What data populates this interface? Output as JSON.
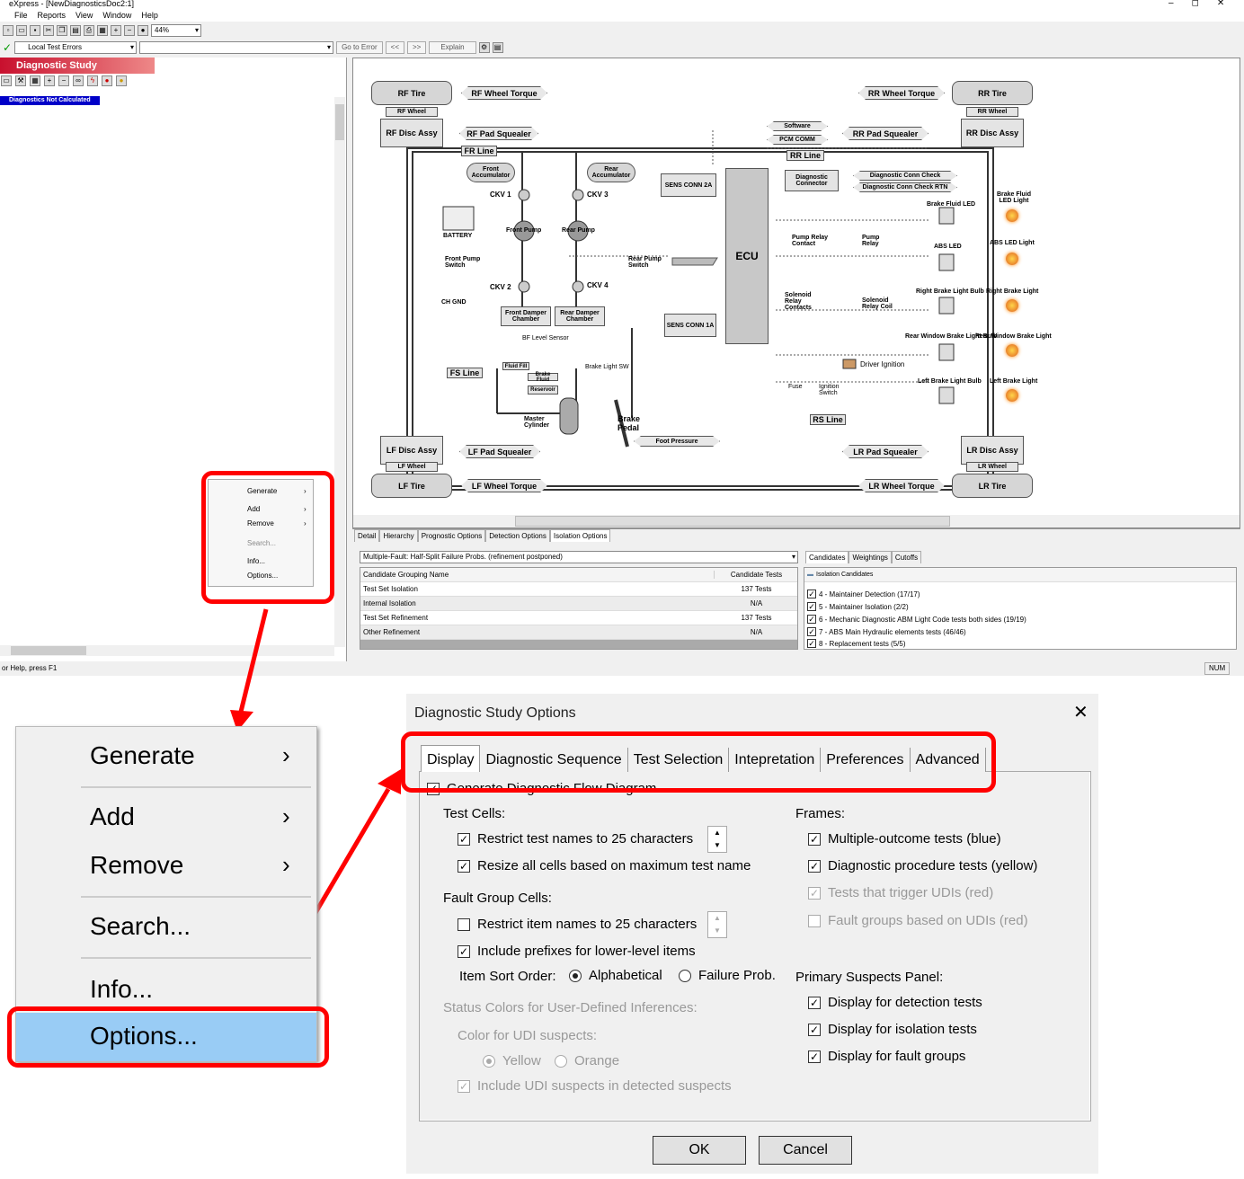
{
  "app": {
    "title": "eXpress - [NewDiagnosticsDoc2:1]",
    "menu": [
      "File",
      "Reports",
      "View",
      "Window",
      "Help"
    ],
    "zoom": "44%",
    "filter": "Local Test Errors",
    "buttons": {
      "goto_error": "Go to Error",
      "prev": "<<",
      "next": ">>",
      "explain": "Explain"
    },
    "window_controls": [
      "–",
      "◻",
      "✕"
    ]
  },
  "study": {
    "title": "Diagnostic Study",
    "badge": "Diagnostics Not Calculated",
    "badge_color": "#0000c8",
    "title_color": "#c8102e"
  },
  "diagram": {
    "boxes": {
      "rf_tire": "RF Tire",
      "rf_wheel": "RF Wheel",
      "rf_disc": "RF Disc Assy",
      "rr_tire": "RR Tire",
      "rr_wheel": "RR Wheel",
      "rr_disc": "RR Disc Assy",
      "lf_disc": "LF Disc Assy",
      "lf_wheel": "LF Wheel",
      "lf_tire": "LF Tire",
      "lr_disc": "LR Disc Assy",
      "lr_wheel": "LR Wheel",
      "lr_tire": "LR Tire",
      "front_acc": "Front Accumulator",
      "rear_acc": "Rear Accumulator",
      "ecu": "ECU",
      "sens2a": "SENS CONN 2A",
      "sens1a": "SENS CONN 1A",
      "diag_conn": "Diagnostic Connector",
      "front_damper": "Front Damper Chamber",
      "rear_damper": "Rear Damper Chamber",
      "fluid_fill": "Fluid Fill",
      "brake_fluid": "Brake Fluid",
      "reservoir": "Reservoir"
    },
    "arrows": {
      "rf_torque": "RF Wheel Torque",
      "rf_squeal": "RF Pad Squealer",
      "rr_torque": "RR Wheel Torque",
      "rr_squeal": "RR Pad Squealer",
      "lf_torque": "LF Wheel Torque",
      "lf_squeal": "LF Pad Squealer",
      "lr_torque": "LR Wheel Torque",
      "lr_squeal": "LR Pad Squealer",
      "software": "Software",
      "pcm": "PCM COMM",
      "dcc": "Diagnostic Conn Check",
      "dccrtn": "Diagnostic Conn Check RTN",
      "foot_pressure": "Foot Pressure"
    },
    "lines": {
      "fr": "FR Line",
      "rr": "RR Line",
      "fs": "FS Line",
      "rs": "RS Line"
    },
    "labels": {
      "ckv1": "CKV 1",
      "ckv2": "CKV 2",
      "ckv3": "CKV 3",
      "ckv4": "CKV 4",
      "battery": "BATTERY",
      "chgnd": "CH GND",
      "front_pump": "Front Pump",
      "rear_pump": "Rear Pump",
      "front_pump_sw": "Front Pump Switch",
      "rear_pump_sw": "Rear Pump Switch",
      "pump_relay_contact": "Pump Relay Contact",
      "pump_relay": "Pump Relay",
      "solenoid_contacts": "Solenoid Relay Contacts",
      "solenoid_coil": "Solenoid Relay Coil",
      "bf_level": "BF Level Sensor",
      "brake_light_sw": "Brake Light SW",
      "master_cyl": "Master Cylinder",
      "brake_pedal": "Brake Pedal",
      "driver_ignition": "Driver Ignition",
      "fuse": "Fuse",
      "ignition_sw": "Ignition Switch",
      "bf_led": "Brake Fluid LED",
      "abs_led": "ABS LED",
      "right_bulb": "Right Brake Light Bulb",
      "rear_window_bulb": "Rear Window Brake Light Bulb",
      "left_bulb": "Left Brake Light Bulb",
      "bf_led_light": "Brake Fluid LED Light",
      "abs_led_light": "ABS LED Light",
      "right_light": "Right Brake Light",
      "rear_window_light": "Rear Window Brake Light",
      "left_light": "Left Brake Light"
    }
  },
  "bottom": {
    "tabs": [
      "Detail",
      "Hierarchy",
      "Prognostic Options",
      "Detection Options",
      "Isolation Options"
    ],
    "strategy": "Multiple-Fault: Half-Split Failure Probs. (refinement postponed)",
    "columns": [
      "Candidate Grouping Name",
      "Candidate Tests"
    ],
    "rows": [
      {
        "name": "Test Set Isolation",
        "tests": "137 Tests"
      },
      {
        "name": "Internal Isolation",
        "tests": "N/A"
      },
      {
        "name": "Test Set Refinement",
        "tests": "137 Tests"
      },
      {
        "name": "Other Refinement",
        "tests": "N/A"
      }
    ],
    "right_tabs": [
      "Candidates",
      "Weightings",
      "Cutoffs"
    ],
    "candidates_header": "Isolation Candidates",
    "candidates": [
      "4 - Maintainer Detection (17/17)",
      "5 - Maintainer Isolation (2/2)",
      "6 - Mechanic Diagnostic ABM Light Code tests both sides  (19/19)",
      "7 - ABS Main Hydraulic elements tests (46/46)",
      "8 - Replacement tests (5/5)"
    ]
  },
  "status": {
    "help": "or Help, press F1",
    "num": "NUM"
  },
  "context_menu": {
    "items": [
      "Generate",
      "Add",
      "Remove",
      "Search...",
      "Info...",
      "Options..."
    ],
    "highlight_color": "#99ccf5"
  },
  "dialog": {
    "title": "Diagnostic Study Options",
    "tabs": [
      "Display",
      "Diagnostic Sequence",
      "Test Selection",
      "Intepretation",
      "Preferences",
      "Advanced"
    ],
    "generate_flow": "Generate Diagnostic Flow Diagram",
    "test_cells": "Test Cells:",
    "restrict_test": "Restrict test names to 25 characters",
    "resize_cells": "Resize all cells based on maximum test name",
    "fault_group_cells": "Fault Group Cells:",
    "restrict_item": "Restrict item names to 25 characters",
    "include_prefixes": "Include prefixes for lower-level items",
    "sort_order": "Item Sort Order:",
    "alphabetical": "Alphabetical",
    "failure_prob": "Failure Prob.",
    "status_colors": "Status Colors for User-Defined Inferences:",
    "color_udi": "Color for UDI suspects:",
    "yellow": "Yellow",
    "orange": "Orange",
    "include_udi": "Include UDI suspects in detected suspects",
    "frames": "Frames:",
    "multi_outcome": "Multiple-outcome tests (blue)",
    "diag_procedure": "Diagnostic procedure tests (yellow)",
    "trigger_udi": "Tests that trigger UDIs (red)",
    "fault_groups_udi": "Fault groups based on UDIs (red)",
    "primary_panel": "Primary Suspects Panel:",
    "display_detection": "Display for detection tests",
    "display_isolation": "Display for isolation tests",
    "display_fault": "Display for fault groups",
    "ok": "OK",
    "cancel": "Cancel",
    "close": "✕"
  },
  "annotation_color": "#ff0000"
}
